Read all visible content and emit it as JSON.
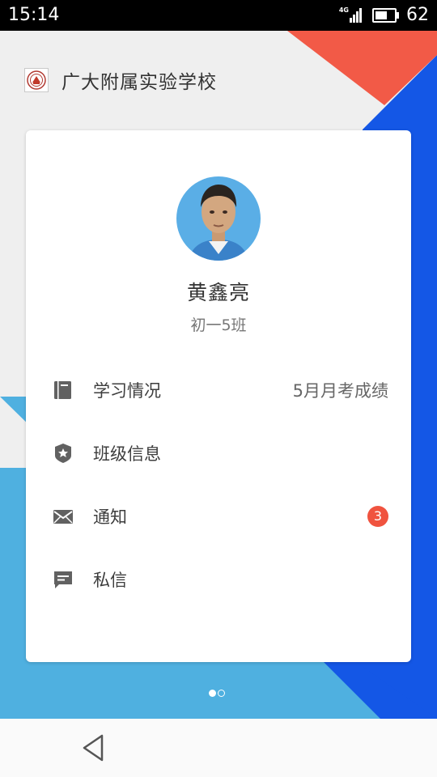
{
  "status_bar": {
    "time": "15:14",
    "network": "4G",
    "battery_percent": "62",
    "signal_bars": 4
  },
  "header": {
    "school_name": "广大附属实验学校",
    "logo_icon": "school-crest-icon"
  },
  "profile": {
    "name": "黄鑫亮",
    "class_name": "初一5班",
    "avatar": "student-photo"
  },
  "menu": {
    "items": [
      {
        "icon": "book-icon",
        "label": "学习情况",
        "value": "5月月考成绩"
      },
      {
        "icon": "shield-star-icon",
        "label": "班级信息"
      },
      {
        "icon": "mail-icon",
        "label": "通知",
        "badge": "3"
      },
      {
        "icon": "chat-icon",
        "label": "私信"
      }
    ]
  },
  "pager": {
    "total": 2,
    "active": 1
  },
  "nav": {
    "back_icon": "back-triangle-icon"
  },
  "colors": {
    "red_band": "#f25a47",
    "blue_band": "#1457e6",
    "light_blue": "#4fb0e0",
    "badge": "#f0533f",
    "icon_gray": "#616161"
  }
}
